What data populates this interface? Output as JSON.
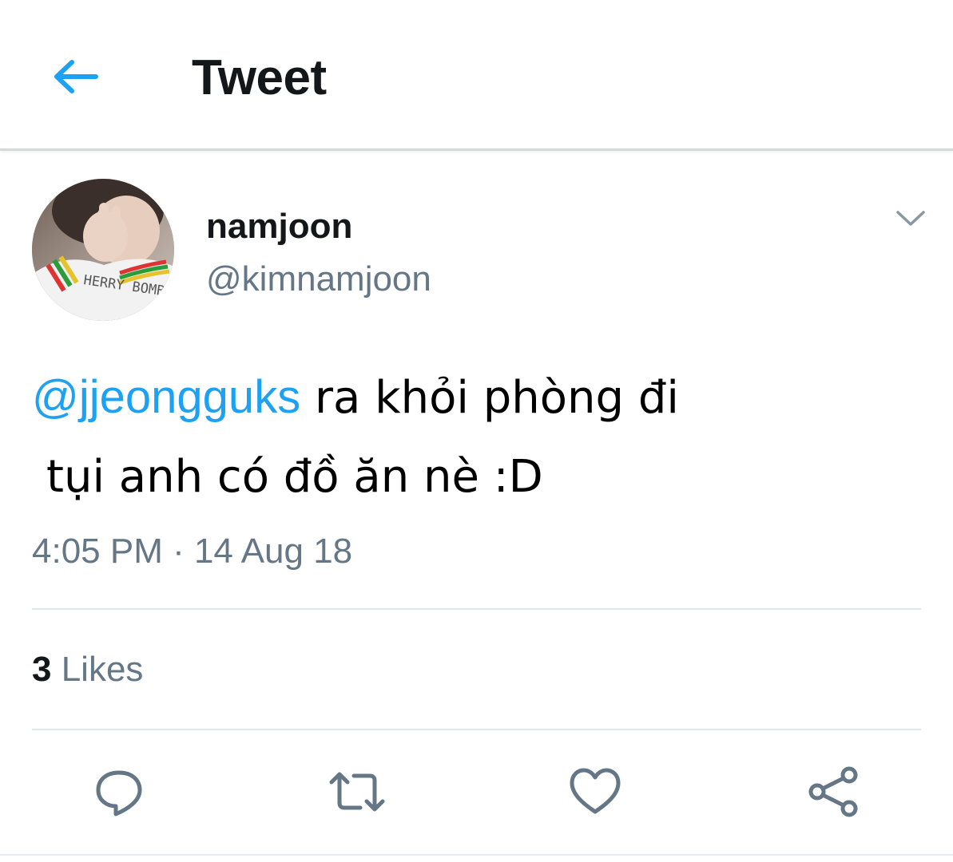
{
  "header": {
    "title": "Tweet",
    "back_icon": "arrow-left-icon",
    "accent_color": "#1da1f2"
  },
  "tweet": {
    "author": {
      "display_name": "namjoon",
      "handle": "@kimnamjoon",
      "avatar_shirt_text": "HERRY BOMB"
    },
    "menu_icon": "chevron-down-icon",
    "mention": "@jjeongguks",
    "text_line1": " ra khỏi phòng đi",
    "text_line2": "tụi anh có đồ ăn nè :D",
    "timestamp": "4:05 PM · 14 Aug 18",
    "likes_count": "3",
    "likes_label": " Likes"
  },
  "actions": [
    {
      "name": "reply",
      "icon": "reply-icon"
    },
    {
      "name": "retweet",
      "icon": "retweet-icon"
    },
    {
      "name": "like",
      "icon": "heart-icon"
    },
    {
      "name": "share",
      "icon": "share-icon"
    }
  ],
  "colors": {
    "text_primary": "#14171a",
    "text_secondary": "#657786",
    "link": "#1da1f2",
    "divider": "#e1e8ed"
  }
}
